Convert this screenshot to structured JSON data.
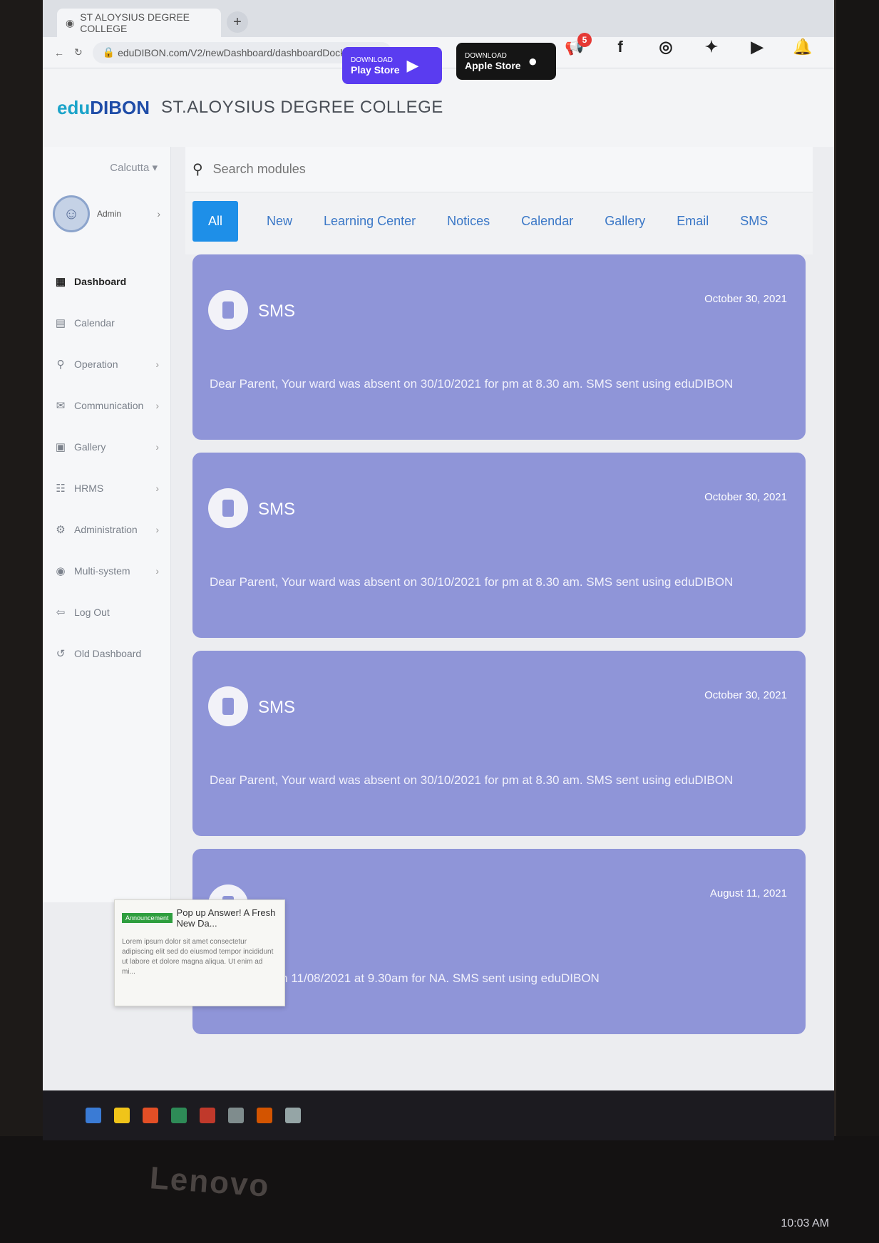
{
  "browser": {
    "tab_title": "ST ALOYSIUS DEGREE COLLEGE",
    "new_tab": "+",
    "url": "eduDIBON.com/V2/newDashboard/dashboardDock"
  },
  "header": {
    "logo_edu": "edu",
    "logo_dibon": "DIBON",
    "college_name": "ST.ALOYSIUS DEGREE COLLEGE",
    "play_store": {
      "small": "DOWNLOAD",
      "big": "Play Store"
    },
    "app_store": {
      "small": "DOWNLOAD",
      "big": "Apple Store"
    },
    "notification_count": "5"
  },
  "sidebar": {
    "year_select": "Calcutta",
    "profile_name": "Admin",
    "items": [
      {
        "label": "Dashboard",
        "icon": "dashboard-icon",
        "glyph": "▦",
        "active": true,
        "chevron": false
      },
      {
        "label": "Calendar",
        "icon": "calendar-icon",
        "glyph": "▤",
        "active": false,
        "chevron": false
      },
      {
        "label": "Operation",
        "icon": "operation-icon",
        "glyph": "⚲",
        "active": false,
        "chevron": true
      },
      {
        "label": "Communication",
        "icon": "communication-icon",
        "glyph": "✉",
        "active": false,
        "chevron": true
      },
      {
        "label": "Gallery",
        "icon": "gallery-icon",
        "glyph": "▣",
        "active": false,
        "chevron": true
      },
      {
        "label": "HRMS",
        "icon": "hrms-icon",
        "glyph": "☷",
        "active": false,
        "chevron": true
      },
      {
        "label": "Administration",
        "icon": "administration-icon",
        "glyph": "⚙",
        "active": false,
        "chevron": true
      },
      {
        "label": "Multi-system",
        "icon": "multisystem-icon",
        "glyph": "◉",
        "active": false,
        "chevron": true
      },
      {
        "label": "Log Out",
        "icon": "logout-icon",
        "glyph": "⇦",
        "active": false,
        "chevron": false
      },
      {
        "label": "Old Dashboard",
        "icon": "old-dashboard-icon",
        "glyph": "↺",
        "active": false,
        "chevron": false
      }
    ]
  },
  "search": {
    "placeholder": "Search modules"
  },
  "tabs": [
    {
      "label": "All",
      "active": true
    },
    {
      "label": "New",
      "active": false
    },
    {
      "label": "Learning Center",
      "active": false
    },
    {
      "label": "Notices",
      "active": false
    },
    {
      "label": "Calendar",
      "active": false
    },
    {
      "label": "Gallery",
      "active": false
    },
    {
      "label": "Email",
      "active": false
    },
    {
      "label": "SMS",
      "active": false
    }
  ],
  "cards": [
    {
      "type": "SMS",
      "date": "October 30, 2021",
      "message": "Dear Parent, Your ward was absent on 30/10/2021 for pm at 8.30 am. SMS sent using eduDIBON"
    },
    {
      "type": "SMS",
      "date": "October 30, 2021",
      "message": "Dear Parent, Your ward was absent on 30/10/2021 for pm at 8.30 am. SMS sent using eduDIBON"
    },
    {
      "type": "SMS",
      "date": "October 30, 2021",
      "message": "Dear Parent, Your ward was absent on 30/10/2021 for pm at 8.30 am. SMS sent using eduDIBON"
    },
    {
      "type": "",
      "date": "August 11, 2021",
      "message": "was absent on 11/08/2021 at 9.30am for NA. SMS sent using eduDIBON"
    }
  ],
  "popup": {
    "tag": "Announcement",
    "title": "Pop up Answer! A Fresh New Da...",
    "body": "Lorem ipsum dolor sit amet consectetur adipiscing elit sed do eiusmod tempor incididunt ut labore et dolore magna aliqua. Ut enim ad mi..."
  },
  "monitor": {
    "brand": "Lenovo",
    "clock": "10:03 AM"
  },
  "colors": {
    "card": "#8f95d8",
    "active_tab": "#1e8fe8",
    "play_store": "#5a3cf0"
  }
}
